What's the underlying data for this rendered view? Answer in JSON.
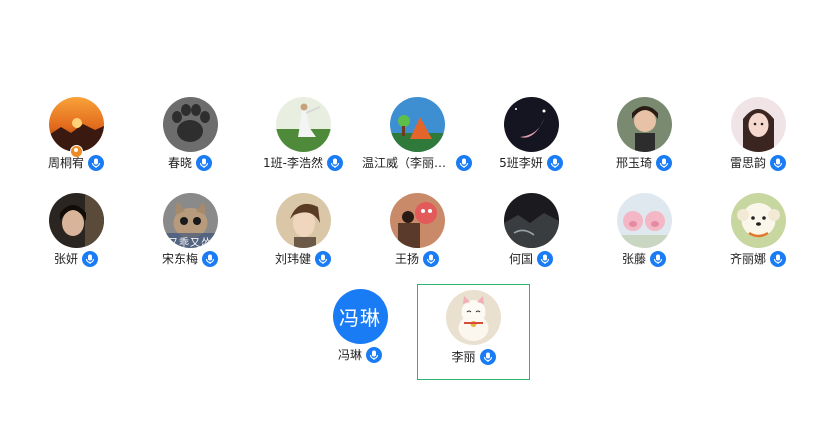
{
  "participants": [
    {
      "name": "周桐宥",
      "avatar": "sunset-avatar",
      "host": true
    },
    {
      "name": "春晓",
      "avatar": "paw-avatar"
    },
    {
      "name": "1班-李浩然",
      "avatar": "dancer-avatar"
    },
    {
      "name": "温江威（李丽老...",
      "avatar": "painting-avatar"
    },
    {
      "name": "5班李妍",
      "avatar": "moon-avatar"
    },
    {
      "name": "邢玉琦",
      "avatar": "girl-photo-avatar"
    },
    {
      "name": "雷思韵",
      "avatar": "girl-portrait-avatar"
    },
    {
      "name": "张妍",
      "avatar": "dark-portrait-avatar"
    },
    {
      "name": "宋东梅",
      "avatar": "cat-avatar",
      "avatar_caption": "又乖又怂"
    },
    {
      "name": "刘玮健",
      "avatar": "anime-man-avatar"
    },
    {
      "name": "王扬",
      "avatar": "cartoon-scene-avatar"
    },
    {
      "name": "何国",
      "avatar": "dark-landscape-avatar"
    },
    {
      "name": "张藤",
      "avatar": "pig-toys-avatar"
    },
    {
      "name": "齐丽娜",
      "avatar": "white-dog-avatar"
    },
    {
      "name": "冯琳",
      "avatar": "text-avatar",
      "avatar_text": "冯琳"
    },
    {
      "name": "李丽",
      "avatar": "lucky-cat-avatar",
      "active_speaker": true
    }
  ],
  "colors": {
    "mic_badge": "#1a7cf5",
    "active_border": "#2db36b",
    "host_badge": "#f08a24"
  }
}
